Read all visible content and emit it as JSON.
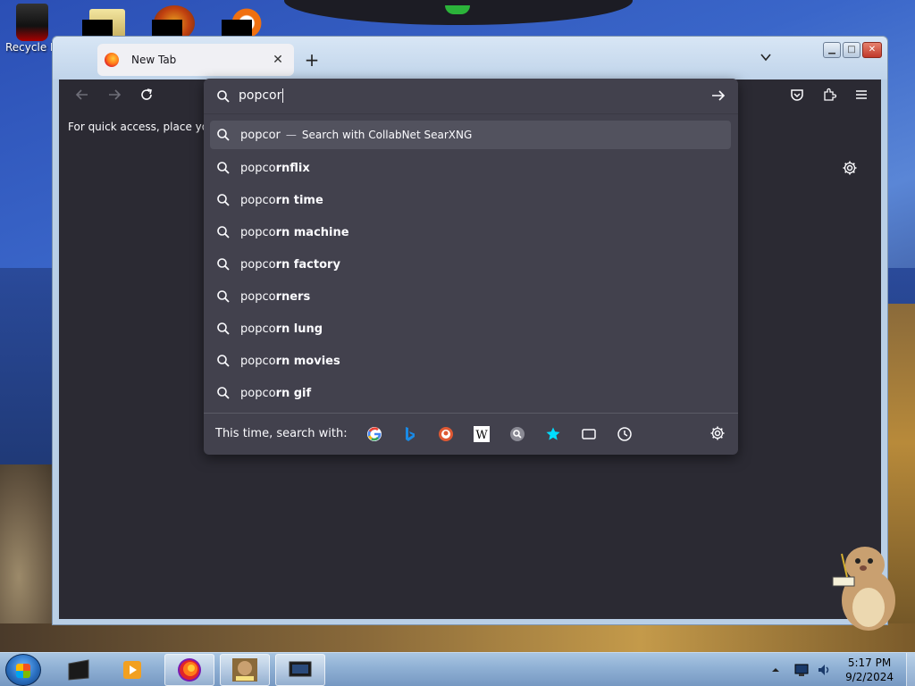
{
  "desktop": {
    "recycle_bin_label": "Recycle Bin"
  },
  "browser": {
    "tab_title": "New Tab",
    "bookmarks_message": "For quick access, place your",
    "url_value": "popcor",
    "colors": {
      "panel": "#42414d",
      "content": "#2b2a33",
      "text": "#fbfbfe",
      "selected": "#52525e"
    },
    "suggestions": [
      {
        "typed": "popcor",
        "completion": "",
        "dash": "—",
        "action": "Search with CollabNet SearXNG",
        "selected": true
      },
      {
        "typed": "popco",
        "completion": "rnflix"
      },
      {
        "typed": "popco",
        "completion": "rn time"
      },
      {
        "typed": "popco",
        "completion": "rn machine"
      },
      {
        "typed": "popco",
        "completion": "rn factory"
      },
      {
        "typed": "popco",
        "completion": "rners"
      },
      {
        "typed": "popco",
        "completion": "rn lung"
      },
      {
        "typed": "popco",
        "completion": "rn movies"
      },
      {
        "typed": "popco",
        "completion": "rn gif"
      }
    ],
    "search_with_label": "This time, search with:",
    "engines": [
      "google-icon",
      "bing-icon",
      "duckduckgo-icon",
      "wikipedia-icon",
      "searxng-icon",
      "bookmarks-icon",
      "tabs-icon",
      "history-icon"
    ]
  },
  "taskbar": {
    "time": "5:17 PM",
    "date": "9/2/2024"
  }
}
